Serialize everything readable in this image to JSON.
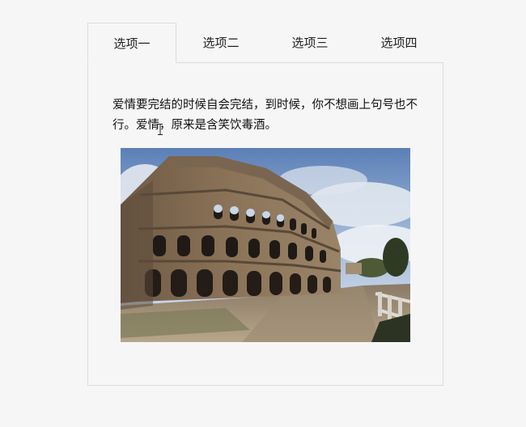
{
  "tabs": [
    {
      "label": "选项一",
      "active": true
    },
    {
      "label": "选项二",
      "active": false
    },
    {
      "label": "选项三",
      "active": false
    },
    {
      "label": "选项四",
      "active": false
    }
  ],
  "panel": {
    "text": "爱情要完结的时候自会完结，到时候，你不想画上句号也不行。爱情，原来是含笑饮毒酒。",
    "image_subject": "colosseum-photo"
  }
}
